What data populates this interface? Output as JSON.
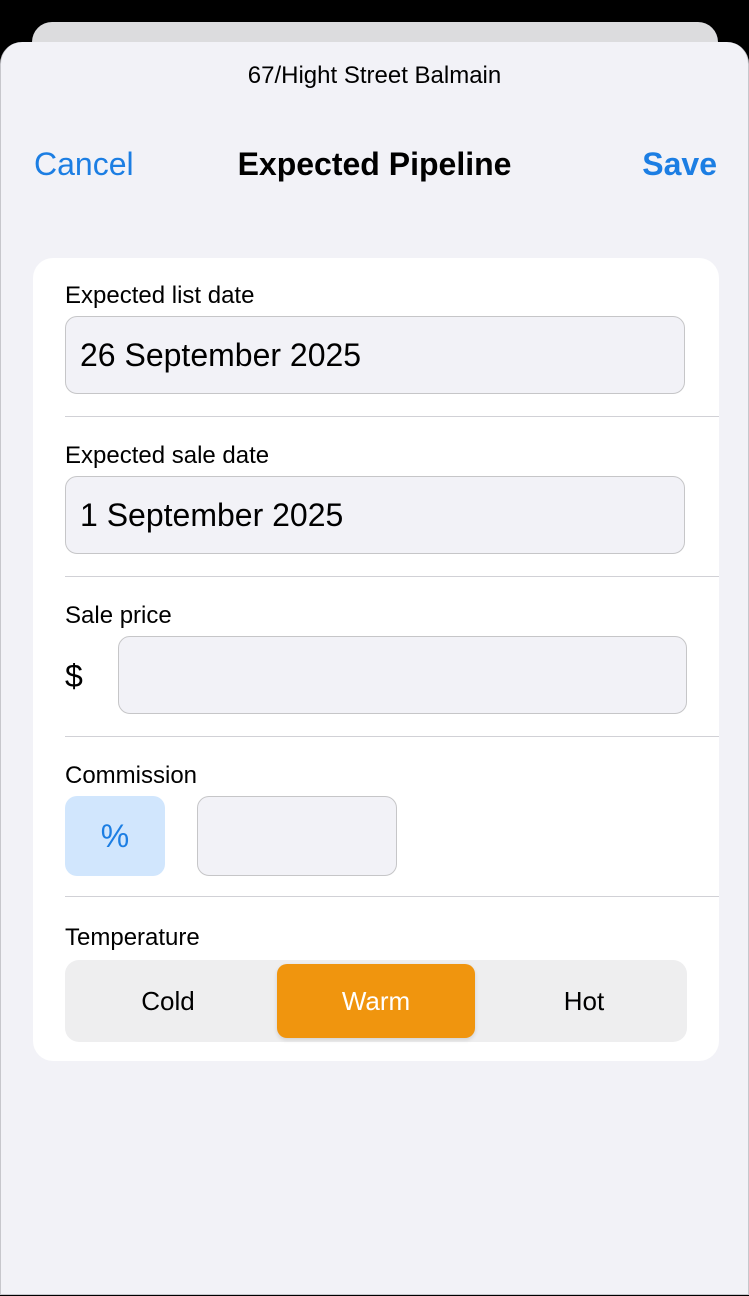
{
  "sheet": {
    "subtitle": "67/Hight Street Balmain"
  },
  "nav": {
    "cancel_label": "Cancel",
    "title": "Expected Pipeline",
    "save_label": "Save"
  },
  "form": {
    "list_date": {
      "label": "Expected list date",
      "value": "26 September 2025"
    },
    "sale_date": {
      "label": "Expected sale date",
      "value": "1 September 2025"
    },
    "sale_price": {
      "label": "Sale price",
      "currency_symbol": "$",
      "value": ""
    },
    "commission": {
      "label": "Commission",
      "unit_label": "%",
      "value": ""
    },
    "temperature": {
      "label": "Temperature",
      "options": [
        "Cold",
        "Warm",
        "Hot"
      ],
      "selected": "Warm"
    }
  },
  "colors": {
    "accent": "#1c7ee3",
    "selected_segment": "#f0950e",
    "percent_button_bg": "#d1e6fd",
    "sheet_bg": "#f2f2f7"
  }
}
